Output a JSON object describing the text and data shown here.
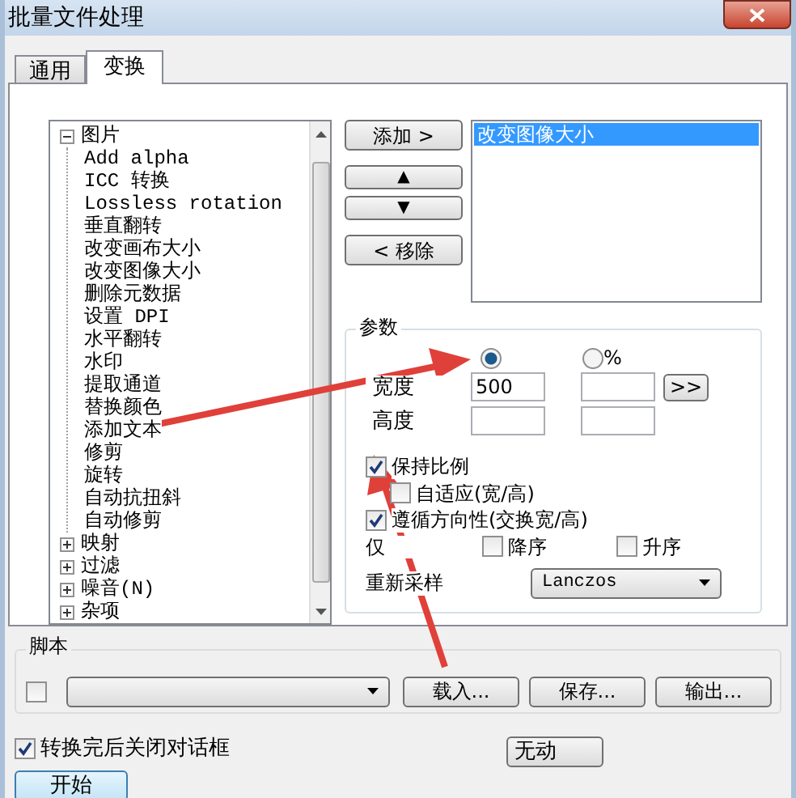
{
  "window": {
    "title": "批量文件处理"
  },
  "tabs": [
    {
      "label": "通用",
      "selected": false
    },
    {
      "label": "变换",
      "selected": true
    }
  ],
  "tree": [
    {
      "label": "图片",
      "expanded": true,
      "children": [
        {
          "label": "Add alpha"
        },
        {
          "label": "ICC 转换"
        },
        {
          "label": "Lossless rotation"
        },
        {
          "label": "垂直翻转"
        },
        {
          "label": "改变画布大小"
        },
        {
          "label": "改变图像大小"
        },
        {
          "label": "删除元数据"
        },
        {
          "label": "设置 DPI"
        },
        {
          "label": "水平翻转"
        },
        {
          "label": "水印"
        },
        {
          "label": "提取通道"
        },
        {
          "label": "替换颜色"
        },
        {
          "label": "添加文本"
        },
        {
          "label": "修剪"
        },
        {
          "label": "旋转"
        },
        {
          "label": "自动抗扭斜"
        },
        {
          "label": "自动修剪"
        }
      ]
    },
    {
      "label": "映射",
      "expanded": false
    },
    {
      "label": "过滤",
      "expanded": false
    },
    {
      "label": "噪音(N)",
      "expanded": false
    },
    {
      "label": "杂项",
      "expanded": false
    }
  ],
  "action_buttons": [
    {
      "kind": "add",
      "label": "添加 >"
    },
    {
      "kind": "up",
      "label": "▲"
    },
    {
      "kind": "down",
      "label": "▼"
    },
    {
      "kind": "remove",
      "label": "< 移除"
    }
  ],
  "queue": [
    {
      "label": "改变图像大小",
      "selected": true
    }
  ],
  "params": {
    "title": "参数",
    "pixel_radio": {
      "selected": true
    },
    "percent_radio": {
      "label": "%",
      "selected": false
    },
    "width": {
      "label": "宽度",
      "value": "500"
    },
    "height": {
      "label": "高度"
    },
    "apply_button": ">>",
    "keep_ratio": {
      "label": "保持比例",
      "checked": true
    },
    "fit": {
      "label": "自适应(宽/高)",
      "checked": false
    },
    "follow_orientation": {
      "label": "遵循方向性(交换宽/高)",
      "checked": true
    },
    "only": {
      "label": "仅",
      "options": [
        {
          "label": "降序",
          "checked": false
        },
        {
          "label": "升序",
          "checked": false
        }
      ]
    },
    "resample": {
      "label": "重新采样",
      "value": "Lanczos"
    }
  },
  "script": {
    "title": "脚本",
    "checked": false,
    "buttons": [
      "载入...",
      "保存...",
      "输出..."
    ]
  },
  "close_after": {
    "label": "转换完后关闭对话框",
    "checked": true
  },
  "idle_button": "无动",
  "start_button": "开始"
}
